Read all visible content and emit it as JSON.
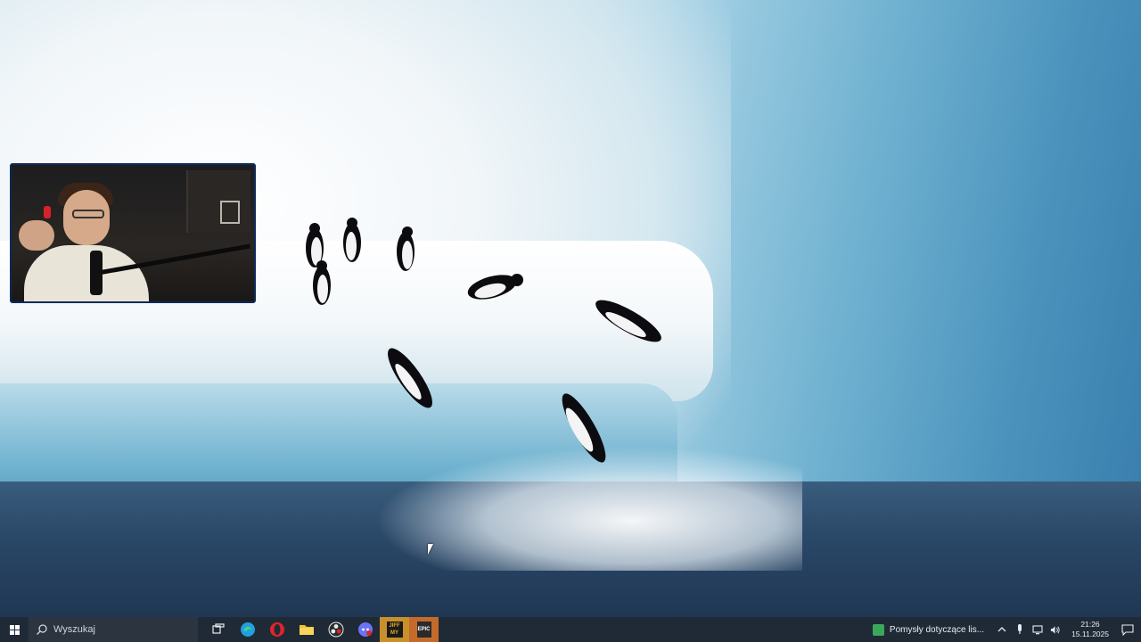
{
  "desktop": {
    "wallpaper": "penguins-on-iceberg",
    "colors": {
      "ice_light": "#f1f6f9",
      "ice_blue": "#6fb1d0",
      "water": "#2a4868"
    }
  },
  "webcam": {
    "border_color": "#0d2a5a"
  },
  "taskbar": {
    "background": "#202a36",
    "search": {
      "placeholder": "Wyszukaj"
    },
    "apps": [
      {
        "name": "task-view",
        "icon": "task-view-icon"
      },
      {
        "name": "edge",
        "icon": "edge-icon",
        "color": "#1fa0e0"
      },
      {
        "name": "opera",
        "icon": "opera-icon",
        "color": "#e0242b"
      },
      {
        "name": "file-explorer",
        "icon": "folder-icon",
        "color": "#f2c232"
      },
      {
        "name": "obs",
        "icon": "obs-icon"
      },
      {
        "name": "discord",
        "icon": "discord-icon",
        "color": "#6b73f5"
      },
      {
        "name": "jiffy-my",
        "icon": "jiffy-my-icon",
        "label_top": "JIFF",
        "label_bottom": "MY",
        "color": "#e5b02a"
      },
      {
        "name": "epic-games",
        "icon": "epic-games-icon",
        "label": "EPIC",
        "color": "#c46a2a"
      }
    ],
    "notification": {
      "text": "Pomysły dotyczące lis..."
    },
    "tray": {
      "icons": [
        "chevron-up-icon",
        "microphone-icon",
        "network-icon",
        "volume-icon"
      ]
    },
    "clock": {
      "time": "21:26",
      "date": "15.11.2025"
    }
  }
}
